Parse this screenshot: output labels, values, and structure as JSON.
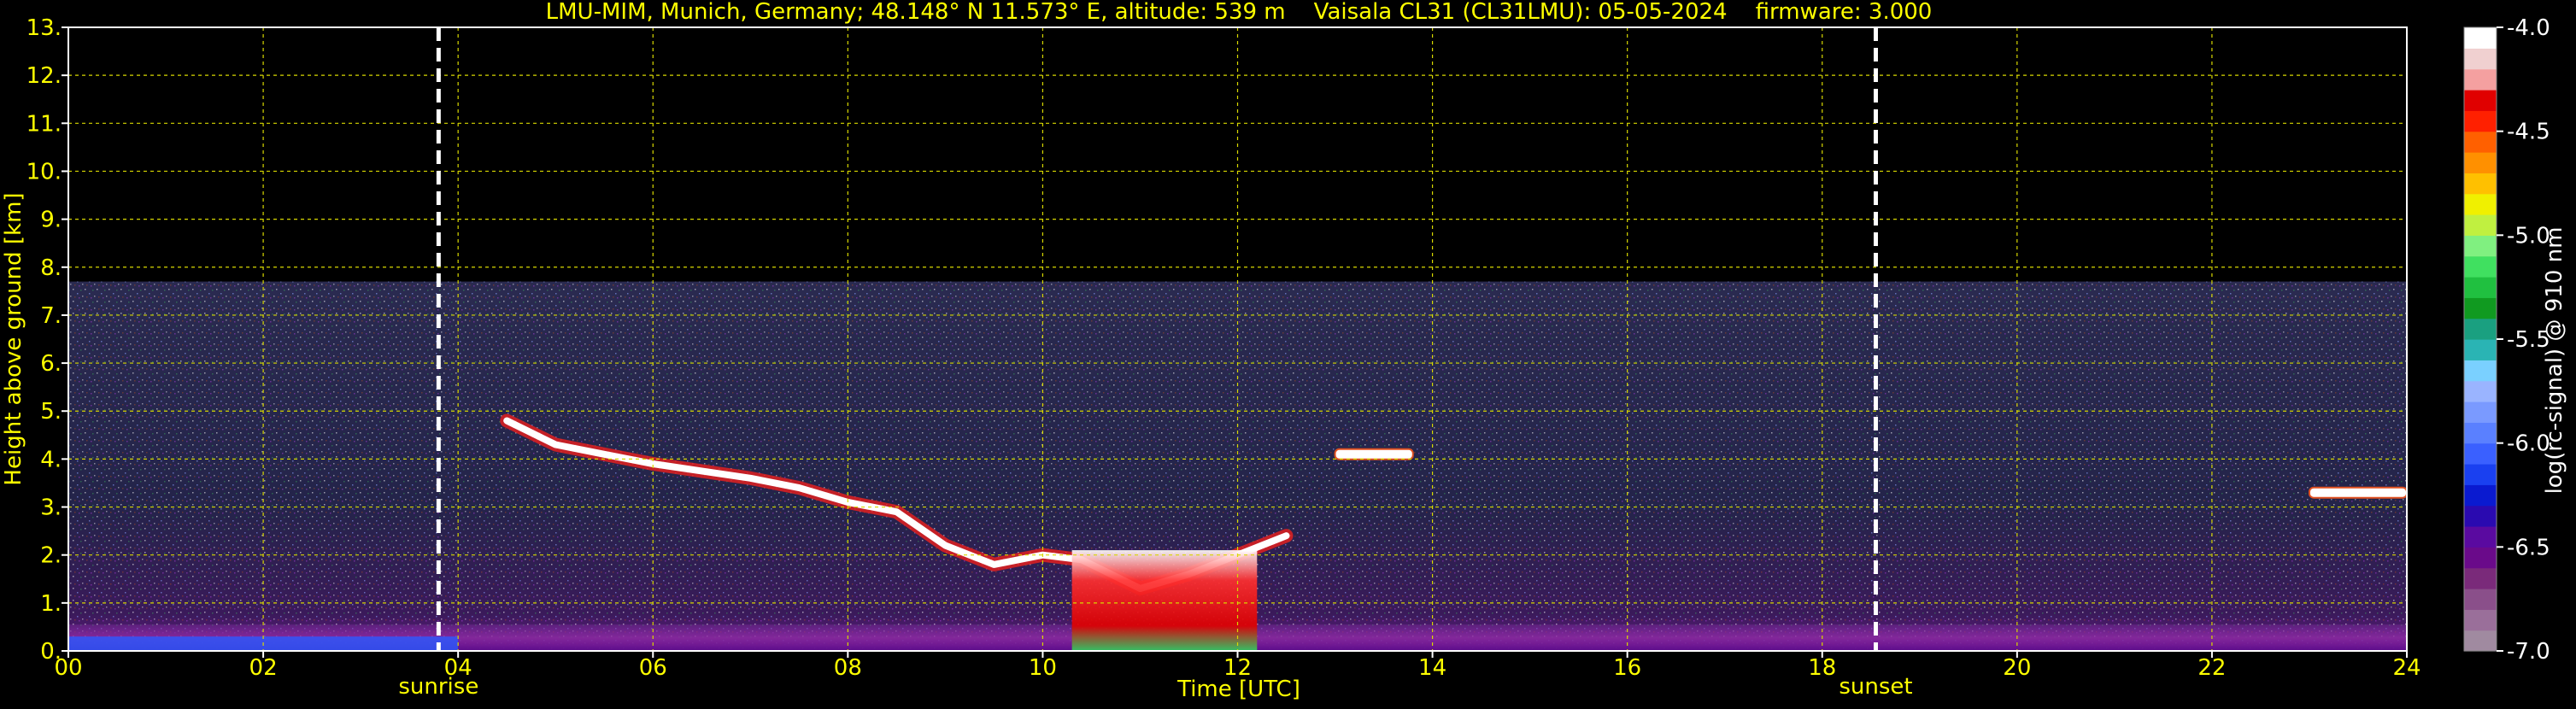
{
  "chart_data": {
    "type": "heatmap",
    "title": "LMU-MIM, Munich, Germany; 48.148° N 11.573° E, altitude: 539 m    Vaisala CL31 (CL31LMU): 05-05-2024    firmware: 3.000",
    "xlabel": "Time [UTC]",
    "ylabel": "Height above ground [km]",
    "xlim": [
      0,
      24
    ],
    "ylim": [
      0,
      13
    ],
    "x_ticks": [
      "00",
      "02",
      "04",
      "06",
      "08",
      "10",
      "12",
      "14",
      "16",
      "18",
      "20",
      "22",
      "24"
    ],
    "x_tick_values": [
      0,
      2,
      4,
      6,
      8,
      10,
      12,
      14,
      16,
      18,
      20,
      22,
      24
    ],
    "y_ticks": [
      "0.",
      "1.",
      "2.",
      "3.",
      "4.",
      "5.",
      "6.",
      "7.",
      "8.",
      "9.",
      "10.",
      "11.",
      "12.",
      "13."
    ],
    "y_tick_values": [
      0,
      1,
      2,
      3,
      4,
      5,
      6,
      7,
      8,
      9,
      10,
      11,
      12,
      13
    ],
    "grid": true,
    "data_top_km": 7.7,
    "markers": [
      {
        "label": "sunrise",
        "time": 3.8
      },
      {
        "label": "sunset",
        "time": 18.55
      }
    ],
    "colorbar": {
      "label": "log(rc-signal) @ 910 nm",
      "range": [
        -7.0,
        -4.0
      ],
      "ticks": [
        "-4.0",
        "-4.5",
        "-5.0",
        "-5.5",
        "-6.0",
        "-6.5",
        "-7.0"
      ],
      "tick_values": [
        -4.0,
        -4.5,
        -5.0,
        -5.5,
        -6.0,
        -6.5,
        -7.0
      ],
      "colors": [
        "#a08aa0",
        "#9a6f9a",
        "#8a4f8a",
        "#7a2a7a",
        "#6a0a8a",
        "#5a0aa0",
        "#2a0ab0",
        "#0a1ad0",
        "#1a40f0",
        "#3a60ff",
        "#5a80ff",
        "#7a9aff",
        "#9ab4ff",
        "#7ad0ff",
        "#2ab4b4",
        "#1aa080",
        "#109a20",
        "#20c040",
        "#40e060",
        "#80f080",
        "#c0f040",
        "#f0f000",
        "#ffc000",
        "#ff9000",
        "#ff6000",
        "#ff2000",
        "#e00000",
        "#f4a0a0",
        "#f0d0d0",
        "#ffffff"
      ]
    },
    "features": [
      {
        "name": "cloud layer",
        "points": [
          [
            4.5,
            4.8
          ],
          [
            5.0,
            4.3
          ],
          [
            5.5,
            4.1
          ],
          [
            6.0,
            3.9
          ],
          [
            6.5,
            3.75
          ],
          [
            7.0,
            3.6
          ],
          [
            7.5,
            3.4
          ],
          [
            8.0,
            3.1
          ],
          [
            8.5,
            2.9
          ],
          [
            9.0,
            2.2
          ],
          [
            9.5,
            1.8
          ],
          [
            10.0,
            2.0
          ],
          [
            10.4,
            1.9
          ],
          [
            11.0,
            1.3
          ],
          [
            11.5,
            1.6
          ],
          [
            12.0,
            2.0
          ],
          [
            12.5,
            2.4
          ]
        ]
      },
      {
        "name": "precipitation",
        "time_range": [
          10.3,
          12.2
        ],
        "max_height_km": 2.1
      },
      {
        "name": "cloud patch",
        "time_range": [
          13.0,
          13.8
        ],
        "height_km": 4.1
      },
      {
        "name": "cloud layer late",
        "time_range": [
          23.0,
          24.0
        ],
        "height_km": 3.3
      }
    ]
  }
}
